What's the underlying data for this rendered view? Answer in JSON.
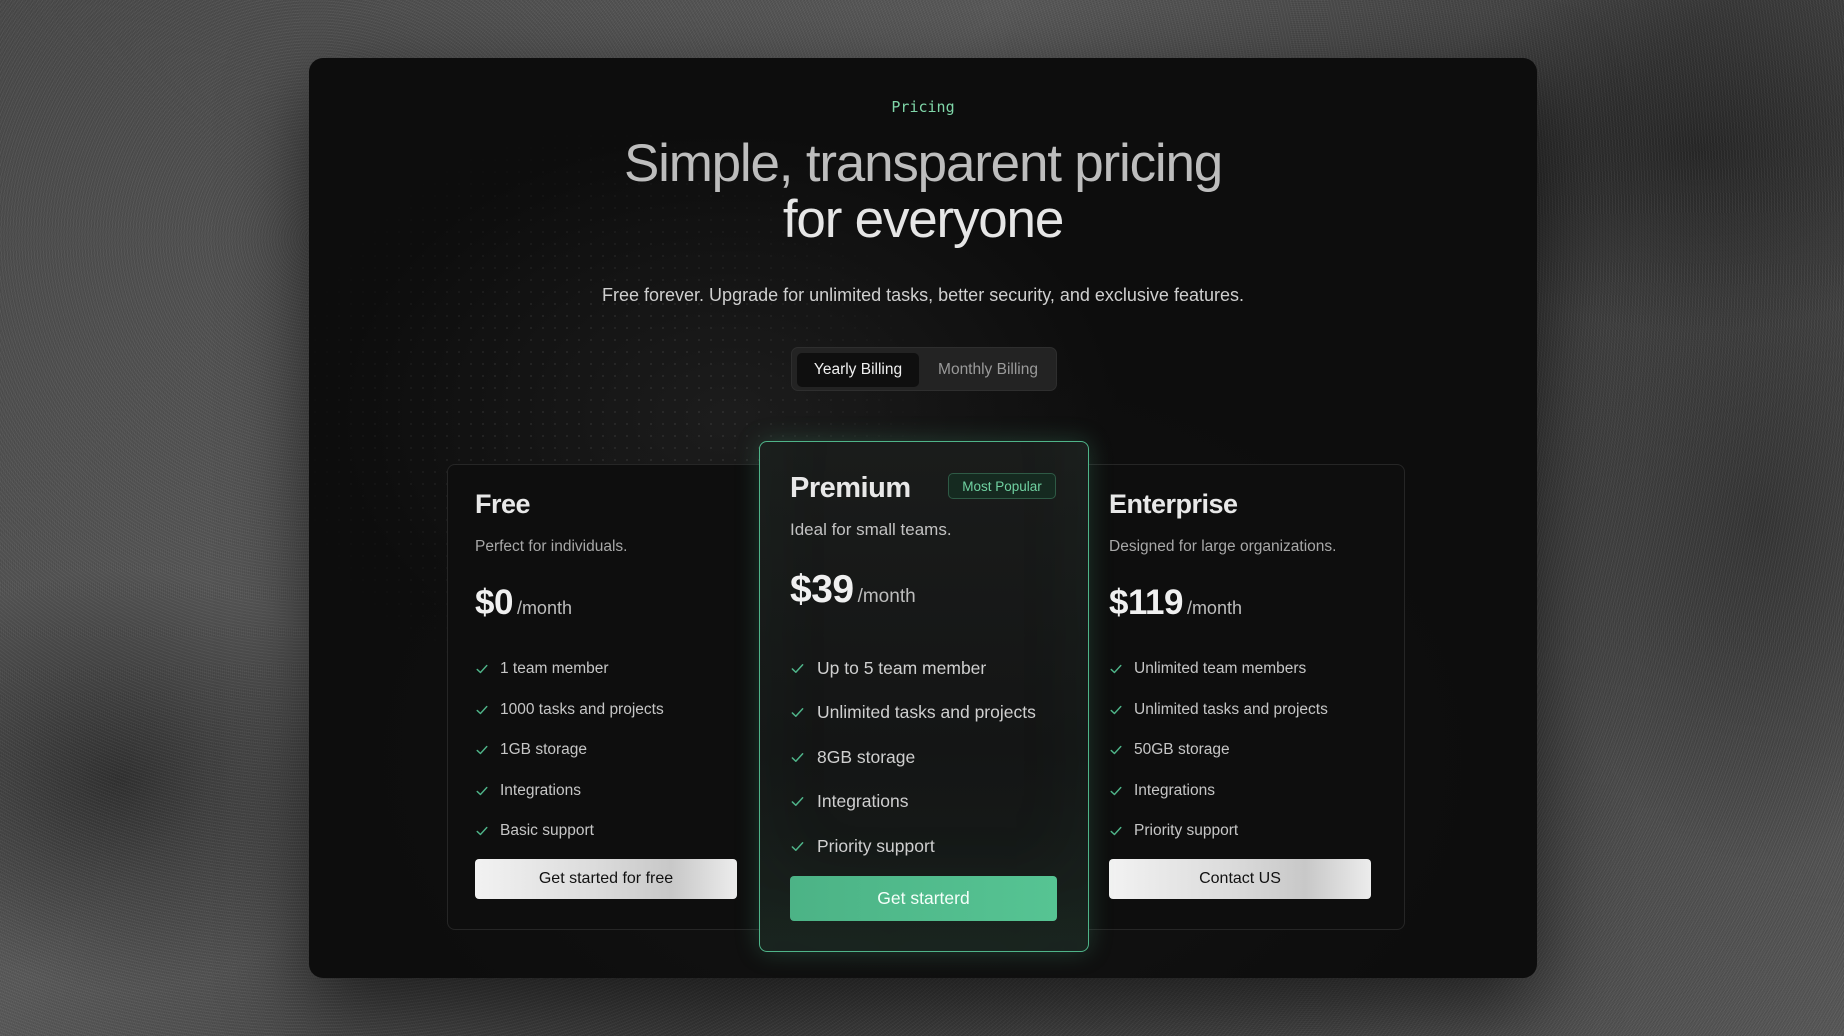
{
  "colors": {
    "accent": "#4fb489",
    "accent_text": "#7fd6a8",
    "panel_bg": "#0d0d0d",
    "card_bg": "#0e0e0e"
  },
  "eyebrow": "Pricing",
  "headline": {
    "line1": "Simple, transparent pricing",
    "line2": "for everyone"
  },
  "subtitle": "Free forever. Upgrade for unlimited tasks, better security, and exclusive features.",
  "billing_toggle": {
    "selected": "Yearly Billing",
    "options": [
      "Yearly Billing",
      "Monthly Billing"
    ]
  },
  "plans": [
    {
      "name": "Free",
      "description": "Perfect for individuals.",
      "price": "$0",
      "period": "/month",
      "features": [
        "1 team member",
        "1000 tasks and projects",
        "1GB storage",
        "Integrations",
        "Basic support"
      ],
      "cta": "Get started for free",
      "icon": "check-icon"
    },
    {
      "name": "Premium",
      "badge": "Most Popular",
      "description": "Ideal for small teams.",
      "price": "$39",
      "period": "/month",
      "features": [
        "Up to 5 team member",
        "Unlimited tasks and projects",
        "8GB storage",
        "Integrations",
        "Priority support"
      ],
      "cta": "Get starterd",
      "icon": "check-icon"
    },
    {
      "name": "Enterprise",
      "description": "Designed for large organizations.",
      "price": "$119",
      "period": "/month",
      "features": [
        "Unlimited team members",
        "Unlimited tasks and projects",
        "50GB storage",
        "Integrations",
        "Priority support"
      ],
      "cta": "Contact US",
      "icon": "check-icon"
    }
  ]
}
